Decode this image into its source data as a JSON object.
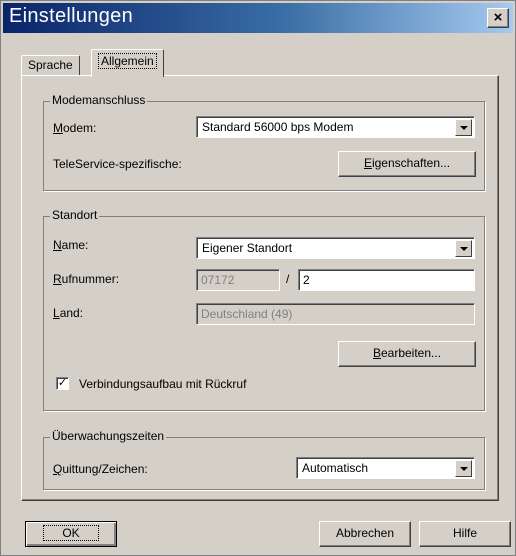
{
  "window": {
    "title": "Einstellungen",
    "close_glyph": "×"
  },
  "tabs": [
    {
      "label": "Sprache",
      "active": false
    },
    {
      "label": "Allgemein",
      "active": true
    }
  ],
  "modem_group": {
    "title": "Modemanschluss",
    "modem_label_u": "M",
    "modem_label_rest": "odem:",
    "modem_value": "Standard 56000 bps Modem",
    "teleservice_label": "TeleService-spezifische:",
    "properties_button_u": "E",
    "properties_button_rest": "igenschaften..."
  },
  "location_group": {
    "title": "Standort",
    "name_label_u": "N",
    "name_label_rest": "ame:",
    "name_value": "Eigener Standort",
    "phone_label_u": "R",
    "phone_label_rest": "ufnummer:",
    "area_code": "07172",
    "separator": "/",
    "phone_extension": "2",
    "country_label_u": "L",
    "country_label_rest": "and:",
    "country_value": "Deutschland (49)",
    "edit_button_u": "B",
    "edit_button_rest": "earbeiten...",
    "callback_checked": true,
    "callback_label": "Verbindungsaufbau mit Rückruf"
  },
  "monitoring_group": {
    "title": "Überwachungszeiten",
    "ack_label_u": "Q",
    "ack_label_rest": "uittung/Zeichen:",
    "ack_value": "Automatisch"
  },
  "footer": {
    "ok_label": "OK",
    "cancel_label": "Abbrechen",
    "help_label": "Hilfe"
  }
}
